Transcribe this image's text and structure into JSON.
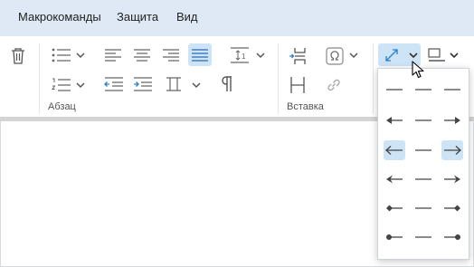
{
  "menubar": {
    "items": [
      {
        "label": "Макрокоманды"
      },
      {
        "label": "Защита"
      },
      {
        "label": "Вид"
      }
    ]
  },
  "ribbon": {
    "groups": [
      {
        "label": "Абзац"
      },
      {
        "label": "Вставка"
      }
    ]
  },
  "icons": {
    "toolbar": [
      "trash-icon",
      "bulleted-list-icon",
      "numbered-list-icon",
      "align-left-icon",
      "align-center-icon",
      "align-right-icon",
      "align-justify-icon",
      "line-spacing-icon",
      "decrease-indent-icon",
      "increase-indent-icon",
      "paragraph-spacing-icon",
      "pilcrow-icon",
      "page-break-icon",
      "column-break-icon",
      "special-character-icon",
      "link-icon",
      "line-style-icon",
      "border-style-icon"
    ]
  },
  "arrow_menu": {
    "rows": [
      [
        "line-plain",
        "line-plain",
        "line-plain"
      ],
      [
        "arrow-filled-left",
        "line-plain",
        "arrow-filled-right"
      ],
      [
        "arrow-open-left",
        "line-plain",
        "arrow-open-right"
      ],
      [
        "arrow-stealth-left",
        "line-plain",
        "arrow-stealth-right"
      ],
      [
        "diamond-left",
        "line-plain",
        "diamond-right"
      ],
      [
        "dot-left",
        "line-plain",
        "dot-right"
      ]
    ],
    "selected_row": 2
  },
  "colors": {
    "menubar_bg": "#dfe9f5",
    "active_bg": "#cde3f6",
    "accent_blue": "#2a7fc9"
  }
}
